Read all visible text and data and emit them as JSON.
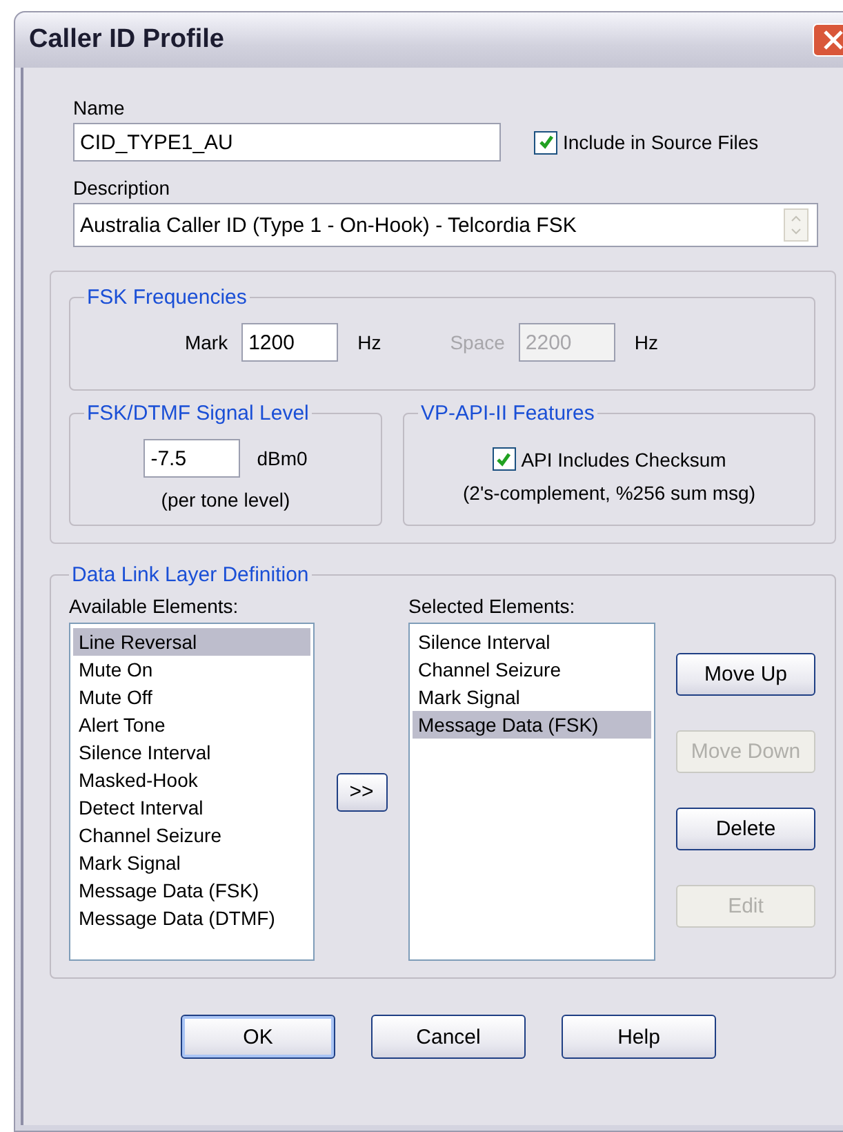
{
  "window": {
    "title": "Caller ID Profile"
  },
  "name": {
    "label": "Name",
    "value": "CID_TYPE1_AU"
  },
  "include_in_source": {
    "label": "Include in Source Files",
    "checked": true
  },
  "description": {
    "label": "Description",
    "value": "Australia Caller ID (Type 1 - On-Hook) - Telcordia FSK"
  },
  "fsk_frequencies": {
    "title": "FSK Frequencies",
    "fields": [
      {
        "label": "Mark",
        "value": "1200",
        "unit": "Hz",
        "disabled": false
      },
      {
        "label": "Space",
        "value": "2200",
        "unit": "Hz",
        "disabled": true
      }
    ]
  },
  "signal_level": {
    "title": "FSK/DTMF Signal Level",
    "value": "-7.5",
    "unit": "dBm0",
    "note": "(per tone level)"
  },
  "features": {
    "title": "VP-API-II Features",
    "checksum": {
      "label": "API Includes Checksum",
      "checked": true
    },
    "note": "(2's-complement, %256 sum msg)"
  },
  "data_link": {
    "title": "Data Link Layer Definition",
    "available": {
      "label": "Available Elements:",
      "items": [
        {
          "label": "Line Reversal",
          "selected": true
        },
        {
          "label": "Mute On",
          "selected": false
        },
        {
          "label": "Mute Off",
          "selected": false
        },
        {
          "label": "Alert Tone",
          "selected": false
        },
        {
          "label": "Silence Interval",
          "selected": false
        },
        {
          "label": "Masked-Hook",
          "selected": false
        },
        {
          "label": "Detect Interval",
          "selected": false
        },
        {
          "label": "Channel Seizure",
          "selected": false
        },
        {
          "label": "Mark Signal",
          "selected": false
        },
        {
          "label": "Message Data (FSK)",
          "selected": false
        },
        {
          "label": "Message Data (DTMF)",
          "selected": false
        }
      ]
    },
    "add_button": ">>",
    "selected": {
      "label": "Selected Elements:",
      "items": [
        {
          "label": "Silence Interval",
          "selected": false
        },
        {
          "label": "Channel Seizure",
          "selected": false
        },
        {
          "label": "Mark Signal",
          "selected": false
        },
        {
          "label": "Message Data (FSK)",
          "selected": true
        }
      ]
    },
    "actions": [
      {
        "label": "Move Up",
        "disabled": false
      },
      {
        "label": "Move Down",
        "disabled": true
      },
      {
        "label": "Delete",
        "disabled": false
      },
      {
        "label": "Edit",
        "disabled": true
      }
    ]
  },
  "buttons": [
    {
      "label": "OK",
      "default": true
    },
    {
      "label": "Cancel",
      "default": false
    },
    {
      "label": "Help",
      "default": false
    }
  ]
}
